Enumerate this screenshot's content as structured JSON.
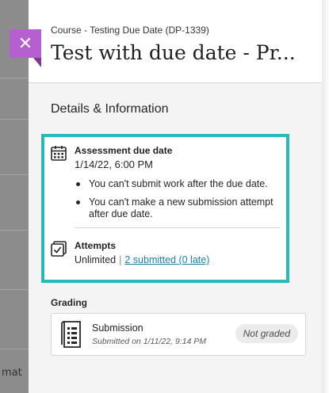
{
  "background": {
    "partial_text": "mat"
  },
  "panel": {
    "close_glyph": "✕",
    "breadcrumb": "Course - Testing Due Date (DP-1339)",
    "title": "Test with due date - Pr..."
  },
  "details": {
    "heading": "Details & Information",
    "due": {
      "icon": "calendar-icon",
      "label": "Assessment due date",
      "date": "1/14/22, 6:00 PM",
      "notes": [
        "You can't submit work after the due date.",
        "You can't make a new submission attempt after due date."
      ]
    },
    "attempts": {
      "icon": "attempts-icon",
      "label": "Attempts",
      "value": "Unlimited",
      "separator": "|",
      "link": "2 submitted (0 late)"
    }
  },
  "grading": {
    "heading": "Grading",
    "submission": {
      "icon": "submission-icon",
      "title": "Submission",
      "date": "Submitted on 1/11/22, 9:14 PM",
      "status": "Not graded"
    }
  },
  "colors": {
    "accent_purple": "#b65fd0",
    "highlight_teal": "#2bb8b8",
    "link_blue": "#1b7fa6"
  }
}
